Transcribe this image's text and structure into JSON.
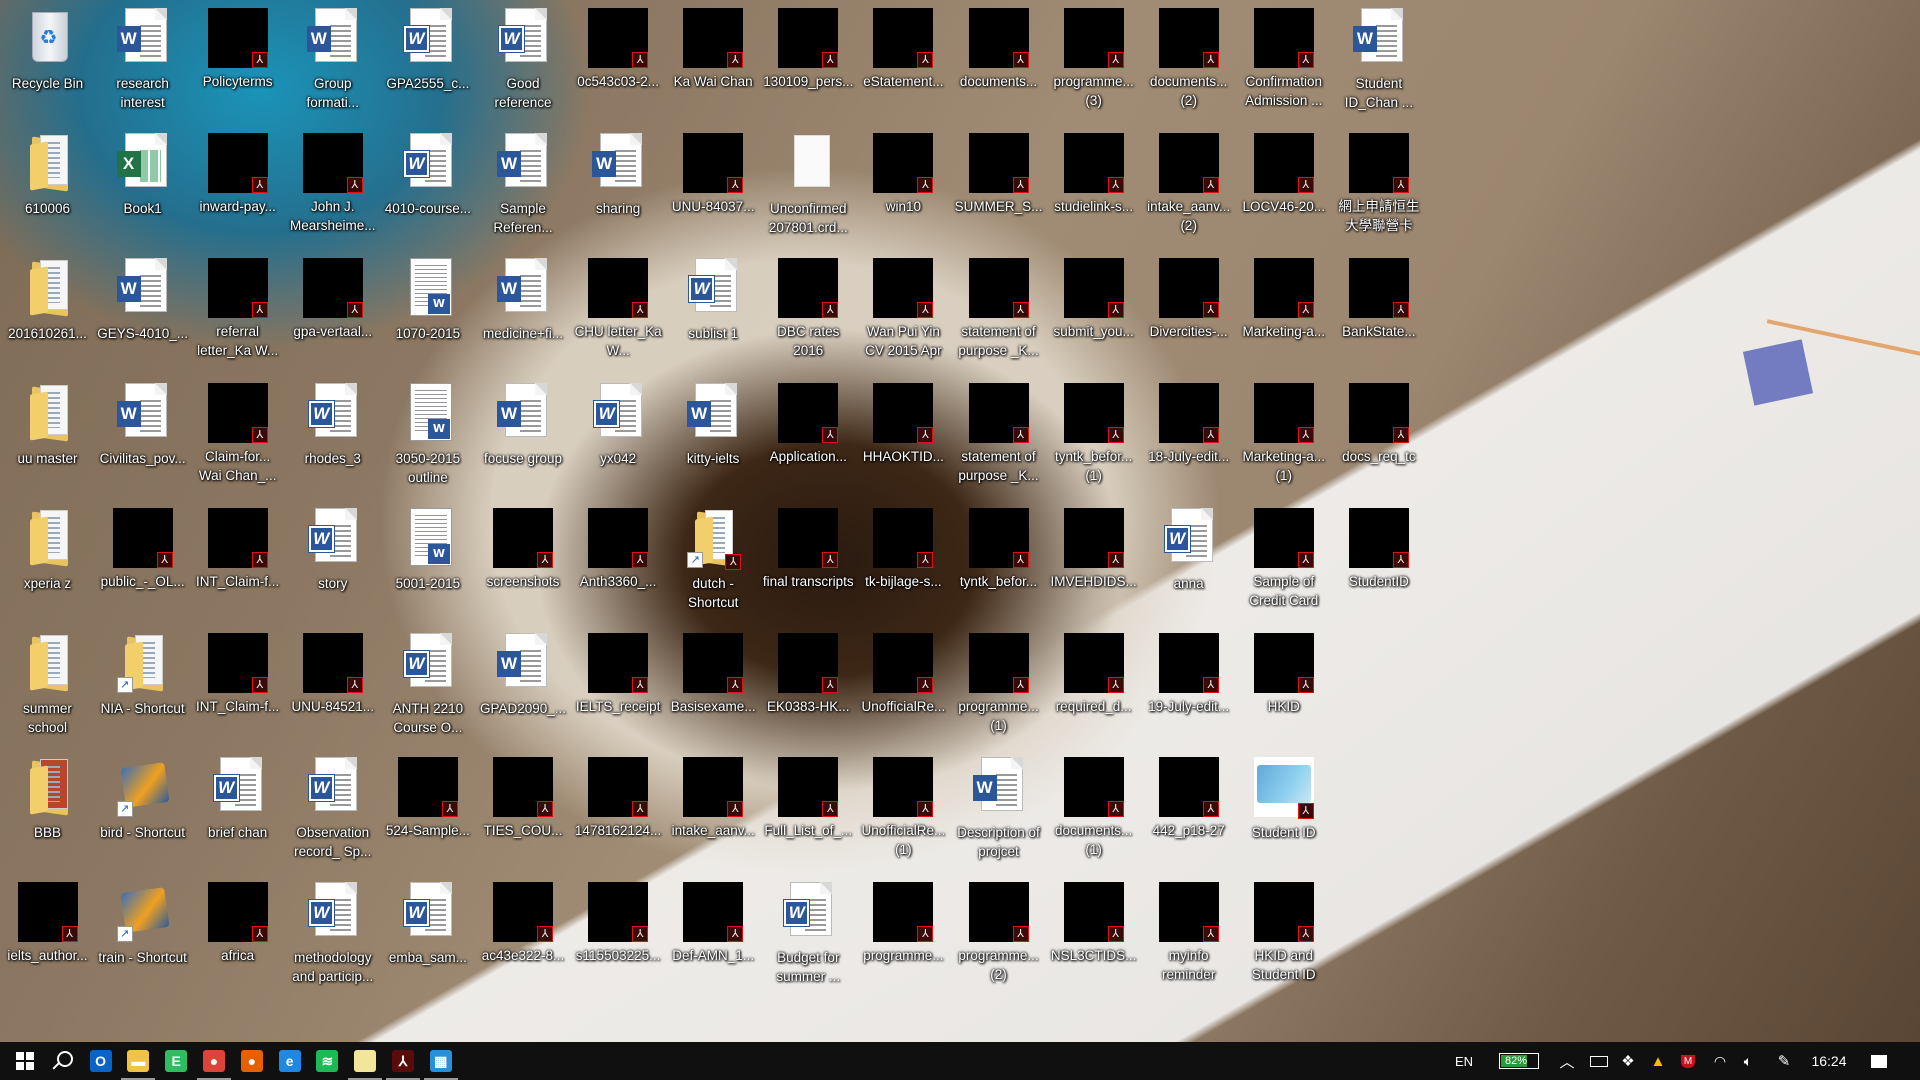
{
  "desktop": {
    "icons": [
      {
        "label": "Recycle Bin",
        "type": "recycle"
      },
      {
        "label": "610006",
        "type": "folder"
      },
      {
        "label": "201610261...",
        "type": "folder"
      },
      {
        "label": "uu master",
        "type": "folder"
      },
      {
        "label": "xperia z",
        "type": "folder"
      },
      {
        "label": "summer school",
        "type": "folder"
      },
      {
        "label": "BBB",
        "type": "folder-red"
      },
      {
        "label": "ielts_author...",
        "type": "pdf"
      },
      {
        "label": "research interest",
        "type": "word"
      },
      {
        "label": "Book1",
        "type": "excel"
      },
      {
        "label": "GEYS-4010_...",
        "type": "word"
      },
      {
        "label": "Civilitas_pov...",
        "type": "word"
      },
      {
        "label": "public_-_OL...",
        "type": "pdf"
      },
      {
        "label": "NIA - Shortcut",
        "type": "folder",
        "shortcut": true
      },
      {
        "label": "bird - Shortcut",
        "type": "video",
        "shortcut": true
      },
      {
        "label": "train - Shortcut",
        "type": "video",
        "shortcut": true
      },
      {
        "label": "Policyterms",
        "type": "pdf"
      },
      {
        "label": "inward-pay...",
        "type": "pdf"
      },
      {
        "label": "referral letter_Ka W...",
        "type": "pdf"
      },
      {
        "label": "Claim-for... Wai Chan_...",
        "type": "pdf"
      },
      {
        "label": "INT_Claim-f...",
        "type": "pdf"
      },
      {
        "label": "INT_Claim-f...",
        "type": "pdf"
      },
      {
        "label": "brief chan",
        "type": "word2"
      },
      {
        "label": "africa",
        "type": "pdf"
      },
      {
        "label": "Group formati...",
        "type": "word"
      },
      {
        "label": "John J. Mearsheime...",
        "type": "pdf"
      },
      {
        "label": "gpa-vertaal...",
        "type": "pdf"
      },
      {
        "label": "rhodes_3",
        "type": "word2"
      },
      {
        "label": "story",
        "type": "word2"
      },
      {
        "label": "UNU-84521...",
        "type": "pdf"
      },
      {
        "label": "Observation record_ Sp...",
        "type": "word2"
      },
      {
        "label": "methodology and particip...",
        "type": "word2"
      },
      {
        "label": "GPA2555_c...",
        "type": "word2"
      },
      {
        "label": "4010-course...",
        "type": "word2"
      },
      {
        "label": "1070-2015",
        "type": "thumb"
      },
      {
        "label": "3050-2015 outline",
        "type": "thumb"
      },
      {
        "label": "5001-2015",
        "type": "thumb"
      },
      {
        "label": "ANTH 2210 Course O...",
        "type": "word2"
      },
      {
        "label": "524-Sample...",
        "type": "pdf"
      },
      {
        "label": "emba_sam...",
        "type": "word2"
      },
      {
        "label": "Good reference",
        "type": "word2"
      },
      {
        "label": "Sample Referen...",
        "type": "word"
      },
      {
        "label": "medicine+fi...",
        "type": "word"
      },
      {
        "label": "focuse group",
        "type": "word"
      },
      {
        "label": "screenshots",
        "type": "pdf"
      },
      {
        "label": "GPAD2090_...",
        "type": "word"
      },
      {
        "label": "TIES_COU...",
        "type": "pdf"
      },
      {
        "label": "ac43e322-8...",
        "type": "pdf"
      },
      {
        "label": "0c543c03-2...",
        "type": "pdf"
      },
      {
        "label": "sharing",
        "type": "word"
      },
      {
        "label": "CHU letter_Ka W...",
        "type": "pdf"
      },
      {
        "label": "yx042",
        "type": "word2"
      },
      {
        "label": "Anth3360_...",
        "type": "pdf"
      },
      {
        "label": "IELTS_receipt",
        "type": "pdf"
      },
      {
        "label": "1478162124...",
        "type": "pdf"
      },
      {
        "label": "s115503225...",
        "type": "pdf"
      },
      {
        "label": "Ka Wai Chan",
        "type": "pdf"
      },
      {
        "label": "UNU-84037...",
        "type": "pdf"
      },
      {
        "label": "sublist 1",
        "type": "word2"
      },
      {
        "label": "kitty-ielts",
        "type": "word"
      },
      {
        "label": "dutch - Shortcut",
        "type": "dutch",
        "shortcut": true
      },
      {
        "label": "Basisexame...",
        "type": "pdf"
      },
      {
        "label": "intake_aanv...",
        "type": "pdf"
      },
      {
        "label": "Def-AMN_1...",
        "type": "pdf"
      },
      {
        "label": "130109_pers...",
        "type": "pdf"
      },
      {
        "label": "Unconfirmed 207801.crd...",
        "type": "blank"
      },
      {
        "label": "DBC rates 2016",
        "type": "pdf"
      },
      {
        "label": "Application...",
        "type": "pdf"
      },
      {
        "label": "final transcripts",
        "type": "pdf"
      },
      {
        "label": "EK0383-HK...",
        "type": "pdf"
      },
      {
        "label": "Full_List_of_...",
        "type": "pdf"
      },
      {
        "label": "Budget for summer ...",
        "type": "word2"
      },
      {
        "label": "eStatement...",
        "type": "pdf"
      },
      {
        "label": "win10",
        "type": "pdf"
      },
      {
        "label": "Wan Pui Yin CV 2015 Apr",
        "type": "pdf"
      },
      {
        "label": "HHAOKTID...",
        "type": "pdf"
      },
      {
        "label": "tk-bijlage-s...",
        "type": "pdf"
      },
      {
        "label": "UnofficialRe...",
        "type": "pdf"
      },
      {
        "label": "UnofficialRe... (1)",
        "type": "pdf"
      },
      {
        "label": "programme...",
        "type": "pdf"
      },
      {
        "label": "documents...",
        "type": "pdf"
      },
      {
        "label": "SUMMER_S...",
        "type": "pdf"
      },
      {
        "label": "statement of purpose _K...",
        "type": "pdf"
      },
      {
        "label": "statement of purpose _K...",
        "type": "pdf"
      },
      {
        "label": "tyntk_befor...",
        "type": "pdf"
      },
      {
        "label": "programme... (1)",
        "type": "pdf"
      },
      {
        "label": "Description of projcet",
        "type": "word"
      },
      {
        "label": "programme... (2)",
        "type": "pdf"
      },
      {
        "label": "programme... (3)",
        "type": "pdf"
      },
      {
        "label": "studielink-s...",
        "type": "pdf"
      },
      {
        "label": "submit_you...",
        "type": "pdf"
      },
      {
        "label": "tyntk_befor... (1)",
        "type": "pdf"
      },
      {
        "label": "IMVEHDIDS...",
        "type": "pdf"
      },
      {
        "label": "required_d...",
        "type": "pdf"
      },
      {
        "label": "documents... (1)",
        "type": "pdf"
      },
      {
        "label": "NSL3CTIDS...",
        "type": "pdf"
      },
      {
        "label": "documents... (2)",
        "type": "pdf"
      },
      {
        "label": "intake_aanv... (2)",
        "type": "pdf"
      },
      {
        "label": "Divercities-...",
        "type": "pdf"
      },
      {
        "label": "18-July-edit...",
        "type": "pdf"
      },
      {
        "label": "anna",
        "type": "word2"
      },
      {
        "label": "19-July-edit...",
        "type": "pdf"
      },
      {
        "label": "442_p18-27",
        "type": "pdf"
      },
      {
        "label": "myinfo reminder",
        "type": "pdf"
      },
      {
        "label": "Confirmation Admission ...",
        "type": "pdf"
      },
      {
        "label": "LOCV46-20...",
        "type": "pdf"
      },
      {
        "label": "Marketing-a...",
        "type": "pdf"
      },
      {
        "label": "Marketing-a... (1)",
        "type": "pdf"
      },
      {
        "label": "Sample of Credit Card",
        "type": "pdf"
      },
      {
        "label": "HKID",
        "type": "pdf"
      },
      {
        "label": "Student ID",
        "type": "card"
      },
      {
        "label": "HKID and Student ID",
        "type": "pdf"
      },
      {
        "label": "Student ID_Chan ...",
        "type": "word"
      },
      {
        "label": "網上申請恒生大學聯營卡",
        "type": "pdf"
      },
      {
        "label": "BankState...",
        "type": "pdf"
      },
      {
        "label": "docs_req_tc",
        "type": "pdf"
      },
      {
        "label": "StudentID",
        "type": "pdf"
      }
    ]
  },
  "taskbar": {
    "apps": [
      {
        "name": "start-button",
        "icon": "windows-icon",
        "running": false
      },
      {
        "name": "search-button",
        "icon": "search-icon",
        "running": false
      },
      {
        "name": "outlook",
        "icon": "outlook-icon",
        "running": false,
        "glyph": "O",
        "color": "#0a64c8"
      },
      {
        "name": "file-explorer",
        "icon": "folder-icon",
        "running": true,
        "glyph": "▬",
        "color": "#f0c24a"
      },
      {
        "name": "evernote",
        "icon": "evernote-icon",
        "running": false,
        "glyph": "E",
        "color": "#2dbe60"
      },
      {
        "name": "chrome",
        "icon": "chrome-icon",
        "running": true,
        "glyph": "●",
        "color": "#db4437"
      },
      {
        "name": "firefox",
        "icon": "firefox-icon",
        "running": false,
        "glyph": "●",
        "color": "#e66000"
      },
      {
        "name": "edge",
        "icon": "edge-icon",
        "running": false,
        "glyph": "e",
        "color": "#1e88e5"
      },
      {
        "name": "spotify",
        "icon": "spotify-icon",
        "running": false,
        "glyph": "≋",
        "color": "#1db954"
      },
      {
        "name": "sticky-notes",
        "icon": "sticky-notes-icon",
        "running": true,
        "glyph": " ",
        "color": "#f3e59a"
      },
      {
        "name": "acrobat",
        "icon": "acrobat-icon",
        "running": true,
        "glyph": "⅄",
        "color": "#5a0c0c"
      },
      {
        "name": "control-panel",
        "icon": "control-panel-icon",
        "running": true,
        "glyph": "▦",
        "color": "#2b8fd6"
      }
    ],
    "tray": {
      "language": "EN",
      "battery_percent": "82%",
      "battery_level": 0.82,
      "clock": "16:24"
    }
  }
}
